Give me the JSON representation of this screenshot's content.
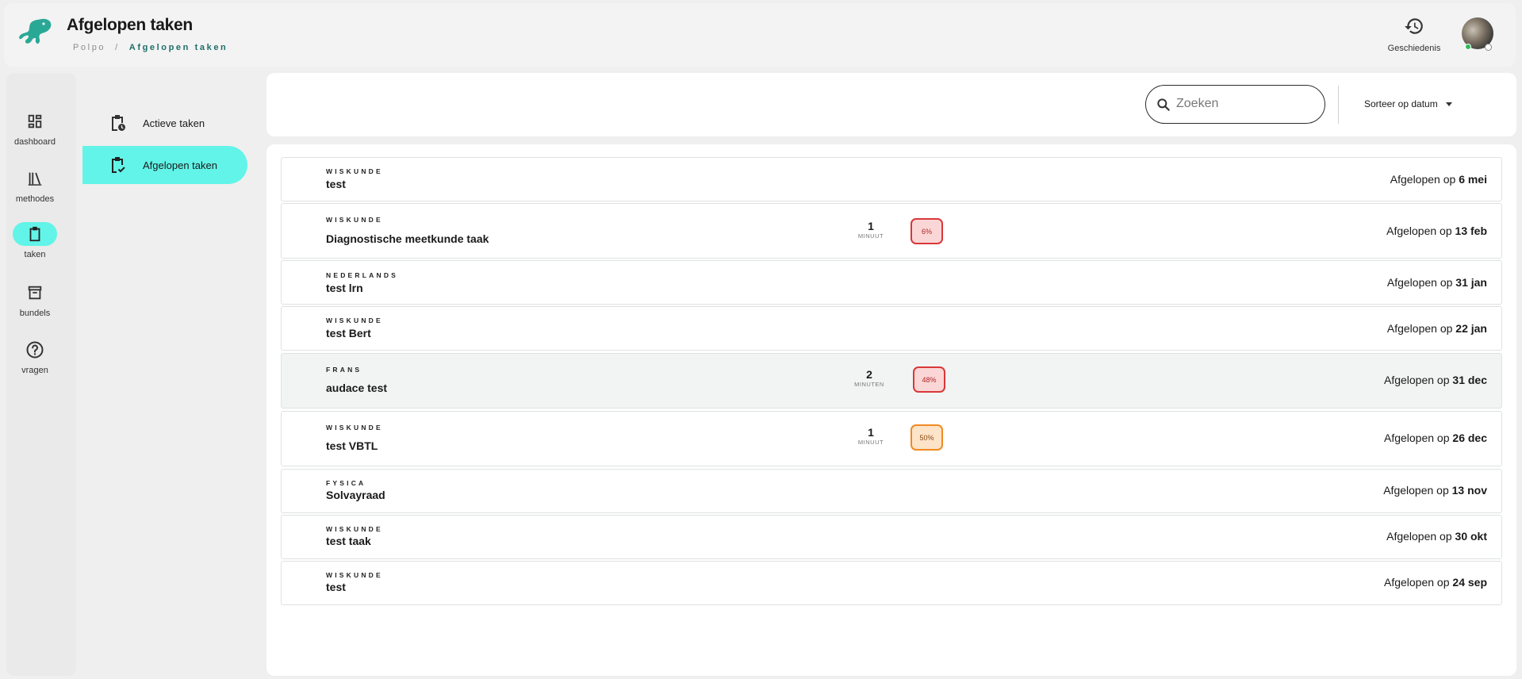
{
  "header": {
    "title": "Afgelopen taken",
    "breadcrumb": {
      "root": "Polpo",
      "separator": "/",
      "current": "Afgelopen taken"
    },
    "history_label": "Geschiedenis"
  },
  "rail": {
    "items": [
      {
        "label": "dashboard",
        "icon": "dashboard-icon"
      },
      {
        "label": "methodes",
        "icon": "library-icon"
      },
      {
        "label": "taken",
        "icon": "clipboard-icon",
        "active": true
      },
      {
        "label": "bundels",
        "icon": "archive-icon"
      },
      {
        "label": "vragen",
        "icon": "help-icon"
      }
    ]
  },
  "subnav": {
    "items": [
      {
        "label": "Actieve taken",
        "icon": "clipboard-clock-icon"
      },
      {
        "label": "Afgelopen taken",
        "icon": "clipboard-check-icon",
        "active": true
      }
    ]
  },
  "toolbar": {
    "search_placeholder": "Zoeken",
    "sort_label": "Sorteer op datum"
  },
  "tasks": [
    {
      "subject": "WISKUNDE",
      "title": "test",
      "expiry_prefix": "Afgelopen op",
      "expiry_date": "6 mei"
    },
    {
      "subject": "WISKUNDE",
      "title": "Diagnostische meetkunde taak",
      "duration": "1",
      "duration_unit": "MINUUT",
      "score": "6%",
      "score_color": "#d9383a",
      "expiry_prefix": "Afgelopen op",
      "expiry_date": "13 feb"
    },
    {
      "subject": "NEDERLANDS",
      "title": "test lrn",
      "expiry_prefix": "Afgelopen op",
      "expiry_date": "31 jan"
    },
    {
      "subject": "WISKUNDE",
      "title": "test Bert",
      "expiry_prefix": "Afgelopen op",
      "expiry_date": "22 jan"
    },
    {
      "subject": "FRANS",
      "title": "audace test",
      "duration": "2",
      "duration_unit": "MINUTEN",
      "score": "48%",
      "score_color": "#d9383a",
      "expiry_prefix": "Afgelopen op",
      "expiry_date": "31 dec"
    },
    {
      "subject": "WISKUNDE",
      "title": "test VBTL",
      "duration": "1",
      "duration_unit": "MINUUT",
      "score": "50%",
      "score_color": "#f08a22",
      "expiry_prefix": "Afgelopen op",
      "expiry_date": "26 dec"
    },
    {
      "subject": "FYSICA",
      "title": "Solvayraad",
      "expiry_prefix": "Afgelopen op",
      "expiry_date": "13 nov"
    },
    {
      "subject": "WISKUNDE",
      "title": "test taak",
      "expiry_prefix": "Afgelopen op",
      "expiry_date": "30 okt"
    },
    {
      "subject": "WISKUNDE",
      "title": "test",
      "expiry_prefix": "Afgelopen op",
      "expiry_date": "24 sep"
    }
  ]
}
